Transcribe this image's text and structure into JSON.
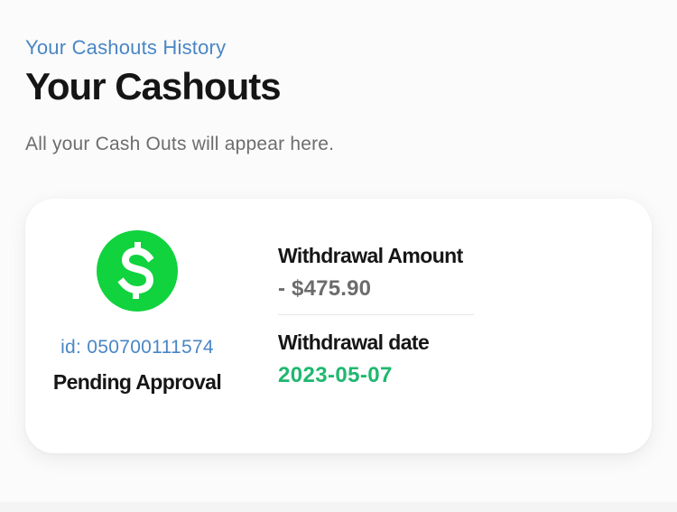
{
  "header": {
    "eyebrow": "Your Cashouts History",
    "title": "Your Cashouts",
    "subtitle": "All your Cash Outs will appear here."
  },
  "cashouts": [
    {
      "icon": "cash-app-dollar-icon",
      "id_text": "id: 050700111574",
      "status": "Pending Approval",
      "amount_label": "Withdrawal Amount",
      "amount": "- $475.90",
      "date_label": "Withdrawal date",
      "date": "2023-05-07"
    }
  ],
  "colors": {
    "accent_blue": "#4a86c5",
    "logo_green": "#10d33d",
    "date_green": "#1fb86f",
    "text_dark": "#161616",
    "text_muted": "#6c6c6c"
  }
}
